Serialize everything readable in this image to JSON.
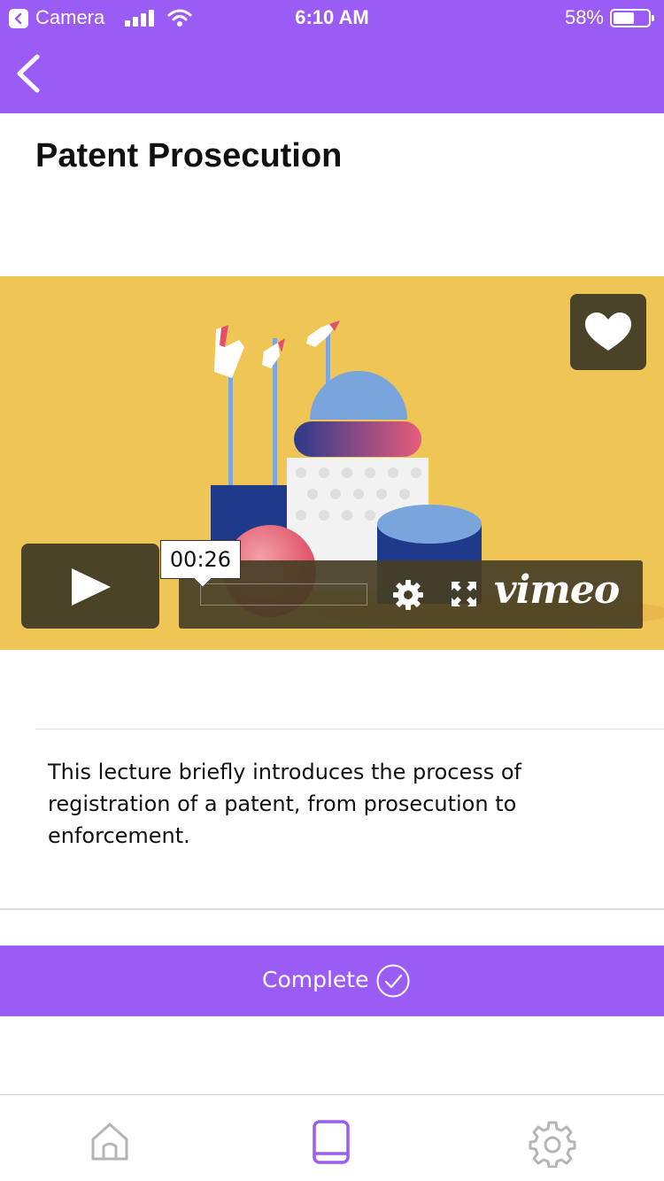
{
  "status_bar": {
    "app": "Camera",
    "time": "6:10 AM",
    "battery": "58%"
  },
  "header": {
    "back_icon": "chevron-left-icon",
    "color": "#9b5cf5"
  },
  "page": {
    "title": "Patent Prosecution"
  },
  "video": {
    "current_time": "00:26",
    "brand": "vimeo",
    "background": "#efc556",
    "icons": [
      "heart-icon",
      "play-icon",
      "settings-icon",
      "fullscreen-icon"
    ]
  },
  "description": "This lecture briefly introduces the process of registration of a patent, from prosecution to enforcement.",
  "complete_button": {
    "label": "Complete",
    "icon": "check-circle-icon"
  },
  "tab_bar": {
    "items": [
      {
        "icon": "home-icon",
        "active": false
      },
      {
        "icon": "book-icon",
        "active": true
      },
      {
        "icon": "gear-icon",
        "active": false
      }
    ],
    "active_color": "#9b5cf5",
    "inactive_color": "#b5b5b5"
  }
}
